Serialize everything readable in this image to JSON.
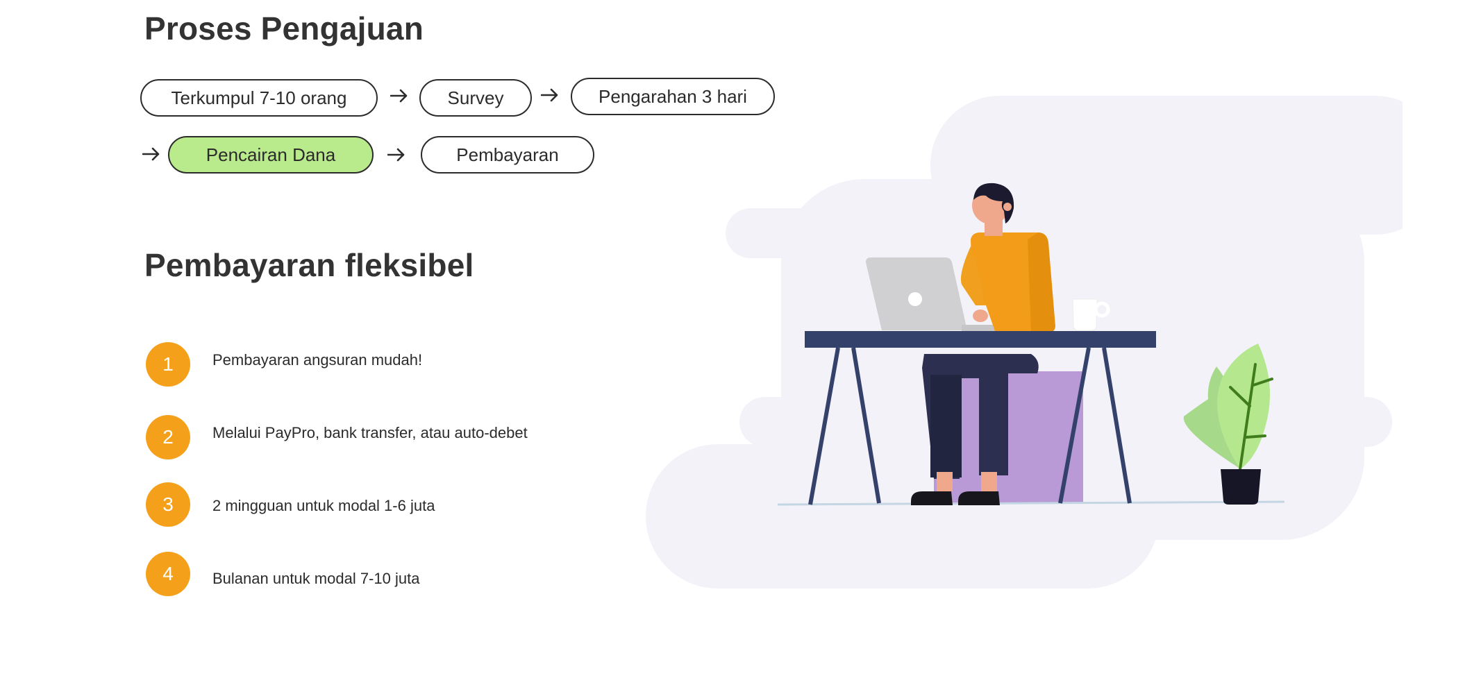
{
  "process": {
    "title": "Proses Pengajuan",
    "steps": [
      {
        "label": "Terkumpul 7-10 orang",
        "active": false
      },
      {
        "label": "Survey",
        "active": false
      },
      {
        "label": "Pengarahan 3 hari",
        "active": false
      },
      {
        "label": "Pencairan Dana",
        "active": true
      },
      {
        "label": "Pembayaran",
        "active": false
      }
    ],
    "arrow_icon": "arrow-right-icon"
  },
  "payment": {
    "title": "Pembayaran fleksibel",
    "items": [
      {
        "number": "1",
        "text": "Pembayaran angsuran mudah!"
      },
      {
        "number": "2",
        "text": "Melalui PayPro, bank transfer, atau auto-debet"
      },
      {
        "number": "3",
        "text": "2 mingguan untuk modal 1-6 juta"
      },
      {
        "number": "4",
        "text": "Bulanan untuk modal 7-10 juta"
      }
    ]
  },
  "colors": {
    "accent_orange": "#f5a01a",
    "active_step_green": "#b9ea8c",
    "illustration_bg": "#f4f2f9",
    "desk_navy": "#34426b"
  },
  "illustration": {
    "name": "person-working-at-laptop-illustration"
  }
}
